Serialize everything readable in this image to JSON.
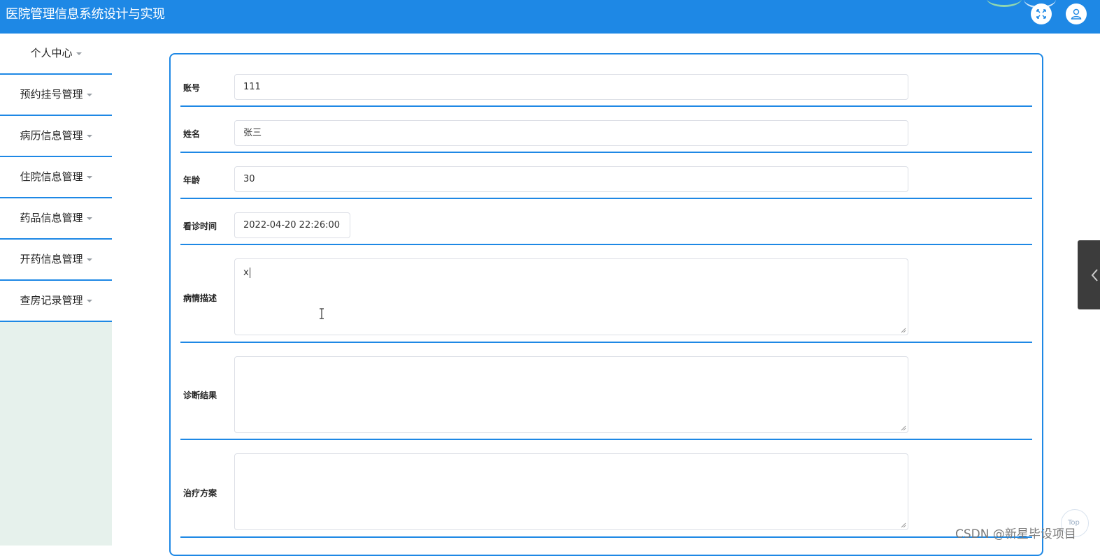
{
  "header": {
    "title": "医院管理信息系统设计与实现",
    "accent_color": "#1e88e5",
    "icons": [
      "fullscreen-icon",
      "user-icon"
    ]
  },
  "sidebar": {
    "items": [
      {
        "label": "个人中心"
      },
      {
        "label": "预约挂号管理"
      },
      {
        "label": "病历信息管理"
      },
      {
        "label": "住院信息管理"
      },
      {
        "label": "药品信息管理"
      },
      {
        "label": "开药信息管理"
      },
      {
        "label": "查房记录管理"
      }
    ]
  },
  "form": {
    "account": {
      "label": "账号",
      "value": "111"
    },
    "name": {
      "label": "姓名",
      "value": "张三"
    },
    "age": {
      "label": "年龄",
      "value": "30"
    },
    "visit_time": {
      "label": "看诊时间",
      "value": "2022-04-20 22:26:00"
    },
    "condition": {
      "label": "病情描述",
      "value": "x"
    },
    "diagnosis": {
      "label": "诊断结果",
      "value": ""
    },
    "treatment": {
      "label": "治疗方案",
      "value": ""
    }
  },
  "back_to_top": {
    "label": "Top"
  },
  "watermark": "CSDN @新星毕设项目"
}
